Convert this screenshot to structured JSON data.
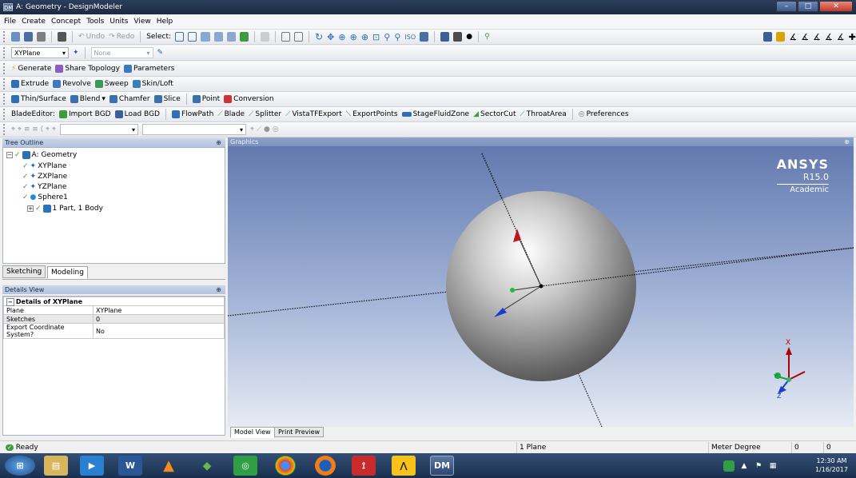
{
  "window": {
    "title": "A: Geometry - DesignModeler",
    "icon_text": "DM"
  },
  "menu": [
    "File",
    "Create",
    "Concept",
    "Tools",
    "Units",
    "View",
    "Help"
  ],
  "toolbar1": {
    "undo": "Undo",
    "redo": "Redo",
    "select": "Select:"
  },
  "toolbar2": {
    "plane": "XYPlane",
    "sketch": "None"
  },
  "toolbar3": {
    "generate": "Generate",
    "share_topology": "Share Topology",
    "parameters": "Parameters"
  },
  "toolbar4": {
    "extrude": "Extrude",
    "revolve": "Revolve",
    "sweep": "Sweep",
    "skin_loft": "Skin/Loft"
  },
  "toolbar5": {
    "thin_surface": "Thin/Surface",
    "blend": "Blend",
    "chamfer": "Chamfer",
    "slice": "Slice",
    "point": "Point",
    "conversion": "Conversion"
  },
  "toolbar6": {
    "bladeeditor": "BladeEditor:",
    "import_bgd": "Import BGD",
    "load_bgd": "Load BGD",
    "flowpath": "FlowPath",
    "blade": "Blade",
    "splitter": "Splitter",
    "vistatf": "VistaTFExport",
    "exportpoints": "ExportPoints",
    "stagefluidzone": "StageFluidZone",
    "sectorcut": "SectorCut",
    "throatarea": "ThroatArea",
    "preferences": "Preferences"
  },
  "tree": {
    "header": "Tree Outline",
    "root": "A: Geometry",
    "items": [
      "XYPlane",
      "ZXPlane",
      "YZPlane",
      "Sphere1",
      "1 Part, 1 Body"
    ]
  },
  "tabs": {
    "sketching": "Sketching",
    "modeling": "Modeling"
  },
  "details": {
    "header": "Details View",
    "title": "Details of XYPlane",
    "rows": [
      {
        "label": "Plane",
        "value": "XYPlane"
      },
      {
        "label": "Sketches",
        "value": "0"
      },
      {
        "label": "Export Coordinate System?",
        "value": "No"
      }
    ]
  },
  "graphics": {
    "header": "Graphics",
    "brand": "ANSYS",
    "version": "R15.0",
    "edition": "Academic",
    "triad_x": "X",
    "triad_y": "Y",
    "triad_z": "Z"
  },
  "viewtabs": {
    "model_view": "Model View",
    "print_preview": "Print Preview"
  },
  "status": {
    "ready": "Ready",
    "selection": "1 Plane",
    "units": "Meter Degree",
    "val1": "0",
    "val2": "0"
  },
  "taskbar": {
    "time": "12:30 AM",
    "date": "1/16/2017",
    "dm_label": "DM"
  }
}
